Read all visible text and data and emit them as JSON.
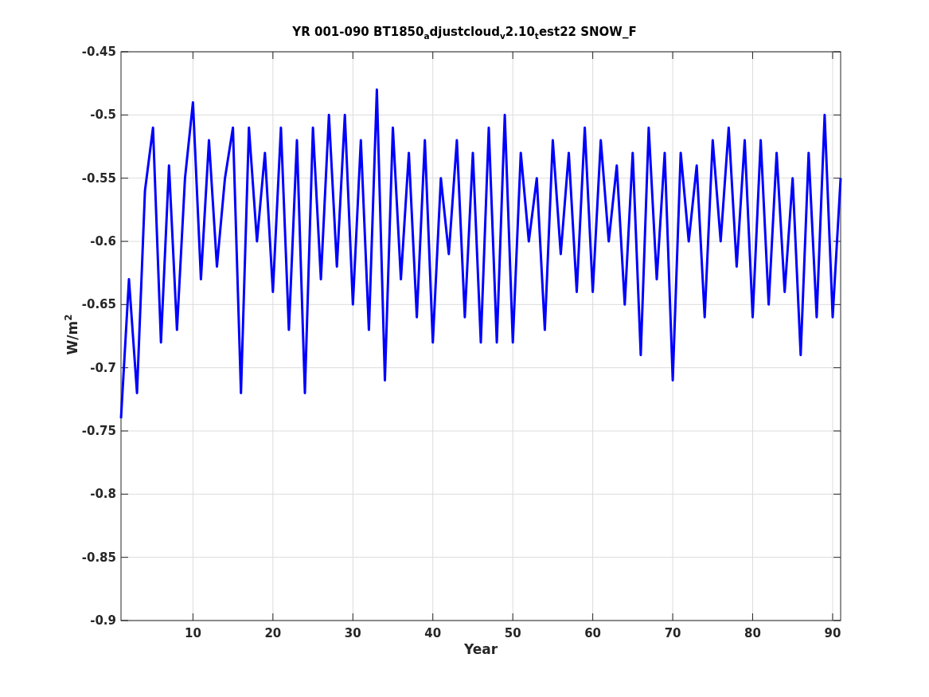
{
  "chart_data": {
    "type": "line",
    "title": "YR 001-090 BT1850$_{a}$djustcloud$_{v}$2.10$_{t}$est22 SNOW_F",
    "xlabel": "Year",
    "ylabel": "W/m$^{2}$",
    "x": [
      1,
      2,
      3,
      4,
      5,
      6,
      7,
      8,
      9,
      10,
      11,
      12,
      13,
      14,
      15,
      16,
      17,
      18,
      19,
      20,
      21,
      22,
      23,
      24,
      25,
      26,
      27,
      28,
      29,
      30,
      31,
      32,
      33,
      34,
      35,
      36,
      37,
      38,
      39,
      40,
      41,
      42,
      43,
      44,
      45,
      46,
      47,
      48,
      49,
      50,
      51,
      52,
      53,
      54,
      55,
      56,
      57,
      58,
      59,
      60,
      61,
      62,
      63,
      64,
      65,
      66,
      67,
      68,
      69,
      70,
      71,
      72,
      73,
      74,
      75,
      76,
      77,
      78,
      79,
      80,
      81,
      82,
      83,
      84,
      85,
      86,
      87,
      88,
      89,
      90,
      91
    ],
    "grid": true,
    "series": [
      {
        "color": "#0000ff",
        "values": [
          -0.74,
          -0.63,
          -0.72,
          -0.56,
          -0.51,
          -0.68,
          -0.54,
          -0.67,
          -0.55,
          -0.49,
          -0.63,
          -0.52,
          -0.62,
          -0.55,
          -0.51,
          -0.72,
          -0.51,
          -0.6,
          -0.53,
          -0.64,
          -0.51,
          -0.67,
          -0.52,
          -0.72,
          -0.51,
          -0.63,
          -0.5,
          -0.62,
          -0.5,
          -0.65,
          -0.52,
          -0.67,
          -0.48,
          -0.71,
          -0.51,
          -0.63,
          -0.53,
          -0.66,
          -0.52,
          -0.68,
          -0.55,
          -0.61,
          -0.52,
          -0.66,
          -0.53,
          -0.68,
          -0.51,
          -0.68,
          -0.5,
          -0.68,
          -0.53,
          -0.6,
          -0.55,
          -0.67,
          -0.52,
          -0.61,
          -0.53,
          -0.64,
          -0.51,
          -0.64,
          -0.52,
          -0.6,
          -0.54,
          -0.65,
          -0.53,
          -0.69,
          -0.51,
          -0.63,
          -0.53,
          -0.71,
          -0.53,
          -0.6,
          -0.54,
          -0.66,
          -0.52,
          -0.6,
          -0.51,
          -0.62,
          -0.52,
          -0.66,
          -0.52,
          -0.65,
          -0.53,
          -0.64,
          -0.55,
          -0.69,
          -0.53,
          -0.66,
          -0.5,
          -0.66,
          -0.55
        ]
      }
    ],
    "xlim": [
      1,
      91
    ],
    "ylim": [
      -0.9,
      -0.45
    ],
    "xticks": [
      10,
      20,
      30,
      40,
      50,
      60,
      70,
      80,
      90
    ],
    "yticks": [
      -0.9,
      -0.85,
      -0.8,
      -0.75,
      -0.7,
      -0.65,
      -0.6,
      -0.55,
      -0.5,
      -0.45
    ]
  }
}
